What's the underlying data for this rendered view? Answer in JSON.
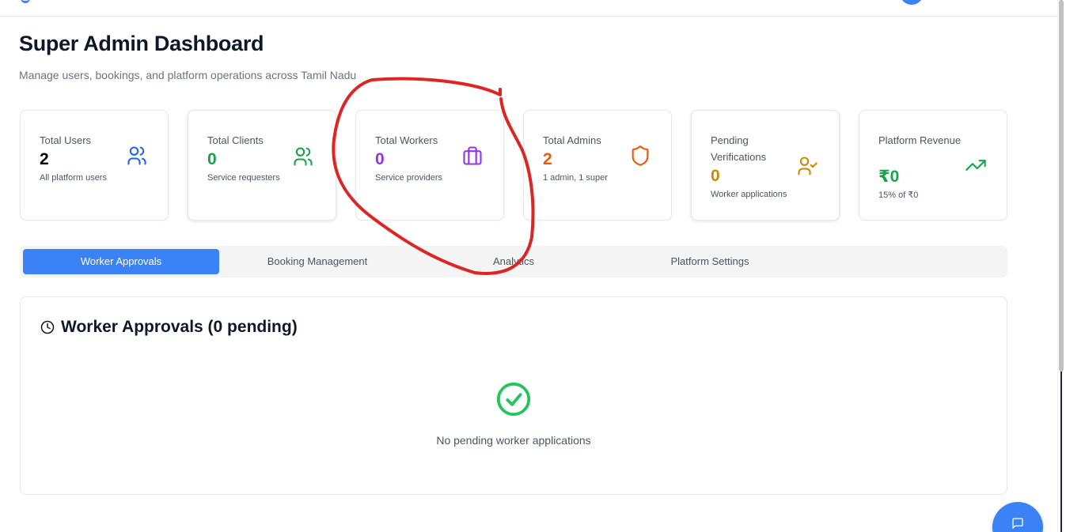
{
  "page": {
    "title": "Super Admin Dashboard",
    "subtitle": "Manage users, bookings, and platform operations across Tamil Nadu"
  },
  "stats": [
    {
      "label": "Total Users",
      "value": "2",
      "sub": "All platform users",
      "color": "#000000",
      "icon": "users-icon",
      "icon_color": "#2563eb"
    },
    {
      "label": "Total Clients",
      "value": "0",
      "sub": "Service requesters",
      "color": "#16a34a",
      "icon": "users-icon",
      "icon_color": "#16a34a"
    },
    {
      "label": "Total Workers",
      "value": "0",
      "sub": "Service providers",
      "color": "#9333ea",
      "icon": "briefcase-icon",
      "icon_color": "#9333ea"
    },
    {
      "label": "Total Admins",
      "value": "2",
      "sub": "1 admin, 1 super",
      "color": "#ea580c",
      "icon": "shield-icon",
      "icon_color": "#ea580c"
    },
    {
      "label": "Pending Verifications",
      "value": "0",
      "sub": "Worker applications",
      "color": "#ca8a04",
      "icon": "user-check-icon",
      "icon_color": "#ca8a04"
    },
    {
      "label": "Platform Revenue",
      "value": "₹0",
      "sub": "15% of ₹0",
      "color": "#16a34a",
      "icon": "trending-up-icon",
      "icon_color": "#16a34a"
    }
  ],
  "tabs": [
    {
      "label": "Worker Approvals",
      "active": true
    },
    {
      "label": "Booking Management",
      "active": false
    },
    {
      "label": "Analytics",
      "active": false
    },
    {
      "label": "Platform Settings",
      "active": false
    }
  ],
  "panel": {
    "title": "Worker Approvals (0 pending)",
    "empty_message": "No pending worker applications",
    "success_color": "#22c55e"
  },
  "colors": {
    "accent": "#3b82f6",
    "annotation": "#dc2626"
  }
}
